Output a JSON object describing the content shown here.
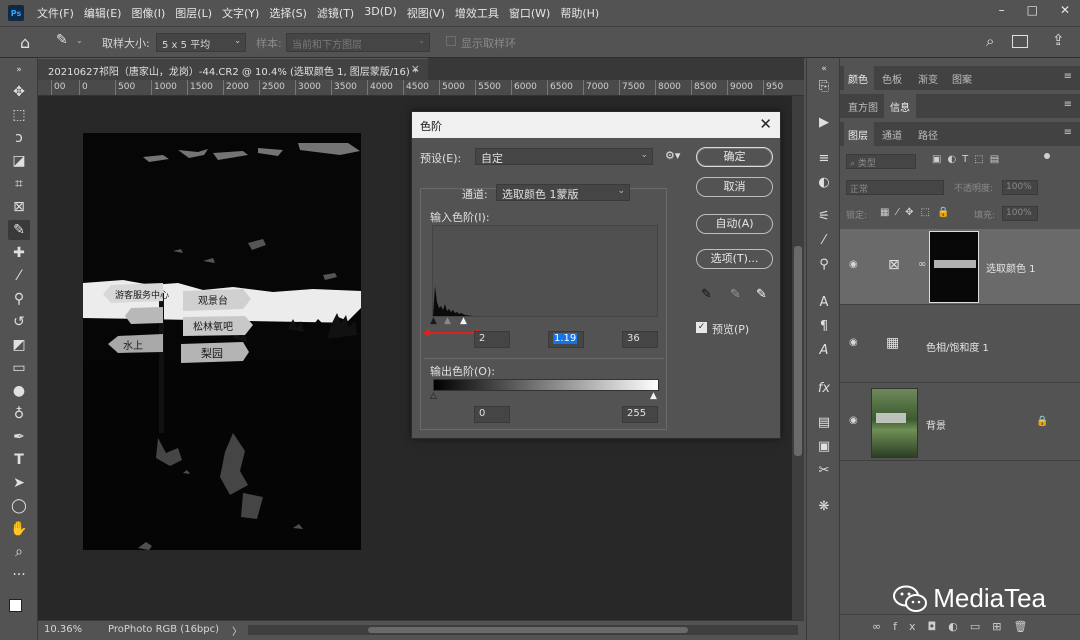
{
  "app": {
    "logo": "Ps"
  },
  "menu": [
    "文件(F)",
    "编辑(E)",
    "图像(I)",
    "图层(L)",
    "文字(Y)",
    "选择(S)",
    "滤镜(T)",
    "3D(D)",
    "视图(V)",
    "增效工具",
    "窗口(W)",
    "帮助(H)"
  ],
  "options": {
    "sample_size_label": "取样大小:",
    "sample_size_value": "5 x 5 平均",
    "sample_label": "样本:",
    "sample_value": "当前和下方图层",
    "show_ring_label": "显示取样环"
  },
  "document": {
    "tab_title": "20210627祁阳（唐家山，龙岗）-44.CR2 @ 10.4% (选取颜色 1, 图层蒙版/16) *",
    "close_symbol": "×"
  },
  "ruler": [
    "00",
    "0",
    "500",
    "1000",
    "1500",
    "2000",
    "2500",
    "3000",
    "3500",
    "4000",
    "4500",
    "5000",
    "5500",
    "6000",
    "6500",
    "7000",
    "7500",
    "8000",
    "8500",
    "9000",
    "950"
  ],
  "status": {
    "zoom": "10.36%",
    "profile": "ProPhoto RGB (16bpc)",
    "arrow": "〉"
  },
  "signs": [
    "游客服务中心",
    "观景台",
    "松林氧吧",
    "梨园",
    "水上"
  ],
  "dialog": {
    "title": "色阶",
    "preset_label": "预设(E):",
    "preset_value": "自定",
    "channel_label": "通道:",
    "channel_value": "选取颜色 1蒙版",
    "input_label": "输入色阶(I):",
    "input_black": "2",
    "input_gamma": "1.19",
    "input_white": "36",
    "output_label": "输出色阶(O):",
    "output_black": "0",
    "output_white": "255",
    "ok": "确定",
    "cancel": "取消",
    "auto": "自动(A)",
    "options": "选项(T)...",
    "preview_label": "预览(P)",
    "preview_checked": true
  },
  "panels": {
    "top_tabs": [
      "颜色",
      "色板",
      "渐变",
      "图案"
    ],
    "mid_tabs": [
      "直方图",
      "信息"
    ],
    "layer_tabs": [
      "图层",
      "通道",
      "路径"
    ],
    "kind_placeholder": "类型",
    "blend_mode": "正常",
    "opacity_label": "不透明度:",
    "opacity_value": "100%",
    "lock_label": "锁定:",
    "fill_label": "填充:",
    "fill_value": "100%",
    "layers": [
      {
        "name": "选取颜色 1",
        "selected": true
      },
      {
        "name": "色相/饱和度 1",
        "selected": false
      },
      {
        "name": "背景",
        "selected": false
      }
    ]
  },
  "watermark": {
    "text": "MediaTea"
  },
  "colors": {
    "accent": "#1473e6",
    "ps_blue": "#31a8ff",
    "red_arrow": "#e02020"
  }
}
